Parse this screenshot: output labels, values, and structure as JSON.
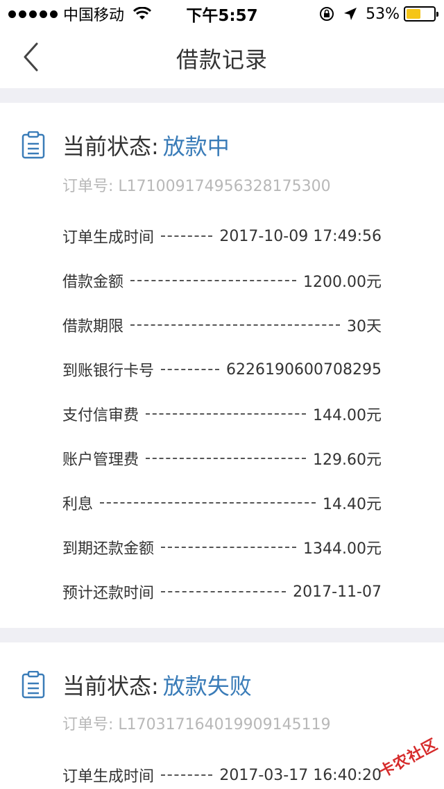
{
  "status_bar": {
    "carrier": "中国移动",
    "time": "下午5:57",
    "battery_percent": "53%",
    "battery_level": 0.53
  },
  "nav": {
    "title": "借款记录"
  },
  "records": [
    {
      "status_label": "当前状态:",
      "status_value": "放款中",
      "order_no": "订单号: L171009174956328175300",
      "rows": [
        {
          "label": "订单生成时间",
          "value": "2017-10-09 17:49:56"
        },
        {
          "label": "借款金额",
          "value": "1200.00元"
        },
        {
          "label": "借款期限",
          "value": "30天"
        },
        {
          "label": "到账银行卡号",
          "value": "6226190600708295"
        },
        {
          "label": "支付信审费",
          "value": "144.00元"
        },
        {
          "label": "账户管理费",
          "value": "129.60元"
        },
        {
          "label": "利息",
          "value": "14.40元"
        },
        {
          "label": "到期还款金额",
          "value": "1344.00元"
        },
        {
          "label": "预计还款时间",
          "value": "2017-11-07"
        }
      ]
    },
    {
      "status_label": "当前状态:",
      "status_value": "放款失败",
      "order_no": "订单号: L170317164019909145119",
      "rows": [
        {
          "label": "订单生成时间",
          "value": "2017-03-17 16:40:20"
        }
      ]
    }
  ],
  "watermark": "卡农社区",
  "colors": {
    "accent": "#3a7cb8",
    "separator": "#efeff4",
    "muted_text": "#b8b8b8",
    "battery": "#f5c518"
  }
}
